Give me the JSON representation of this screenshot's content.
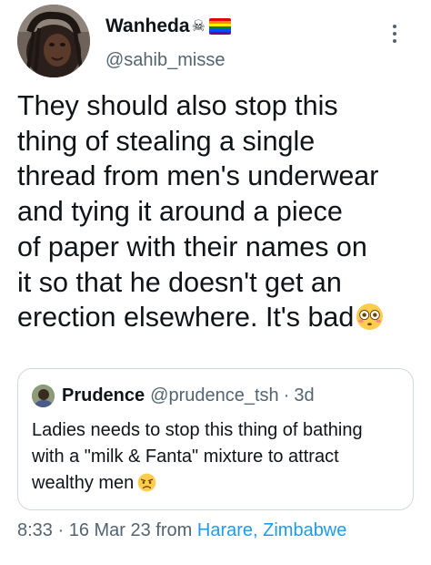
{
  "author": {
    "display_name": "Wanheda",
    "handle": "@sahib_misse",
    "emoji_skull": "☠",
    "avatar_icon": "user-avatar-photo"
  },
  "tweet": {
    "text_lines": [
      "They should also stop this",
      "thing of stealing a single",
      "thread from men's underwear",
      "and tying it around a piece",
      "of paper with their names on",
      "it so that he doesn't get an",
      "erection elsewhere. It's bad"
    ],
    "trailing_emoji": "flushed-face-icon"
  },
  "quote": {
    "display_name": "Prudence",
    "handle": "@prudence_tsh",
    "separator": "·",
    "time": "3d",
    "text_lines": [
      "Ladies needs to stop this thing of bathing",
      "with a \"milk & Fanta\" mixture to attract",
      "wealthy men"
    ],
    "trailing_emoji": "disappointed-face-icon"
  },
  "meta": {
    "time_date": "8:33 · 16 Mar 23 from ",
    "location": "Harare, Zimbabwe"
  },
  "colors": {
    "text": "#0f1419",
    "secondary": "#536471",
    "link": "#1d9bf0",
    "border": "#cfd9de"
  }
}
